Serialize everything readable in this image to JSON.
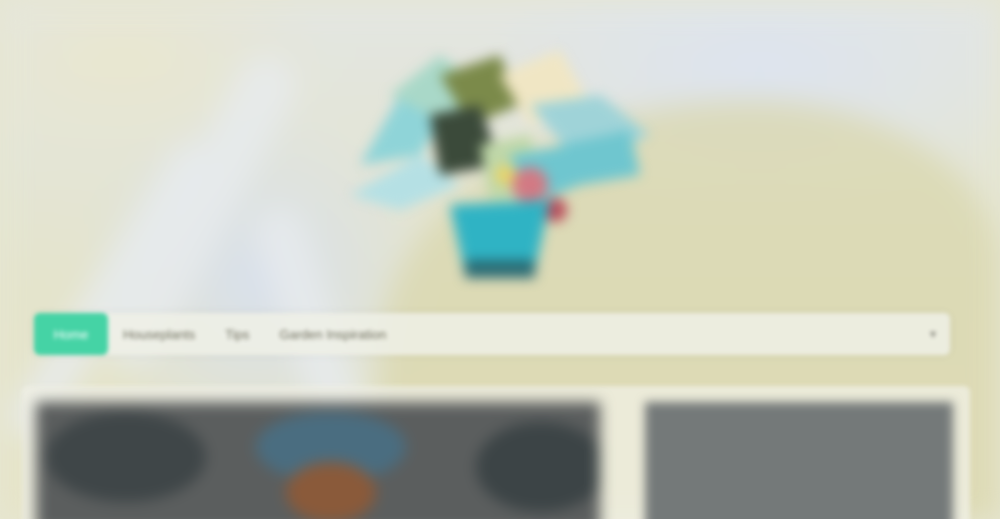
{
  "logo": {
    "icon": "plant-pot-logo-icon"
  },
  "nav": {
    "items": [
      {
        "label": "Home",
        "active": true
      },
      {
        "label": "Houseplants"
      },
      {
        "label": "Tips"
      },
      {
        "label": "Garden Inspiration"
      }
    ],
    "toggle_icon": "chevron-down-icon"
  },
  "colors": {
    "accent": "#45d3a5",
    "nav_background": "#eef0e6",
    "card_dark": "#5b5e5e",
    "card_side": "#747979"
  }
}
